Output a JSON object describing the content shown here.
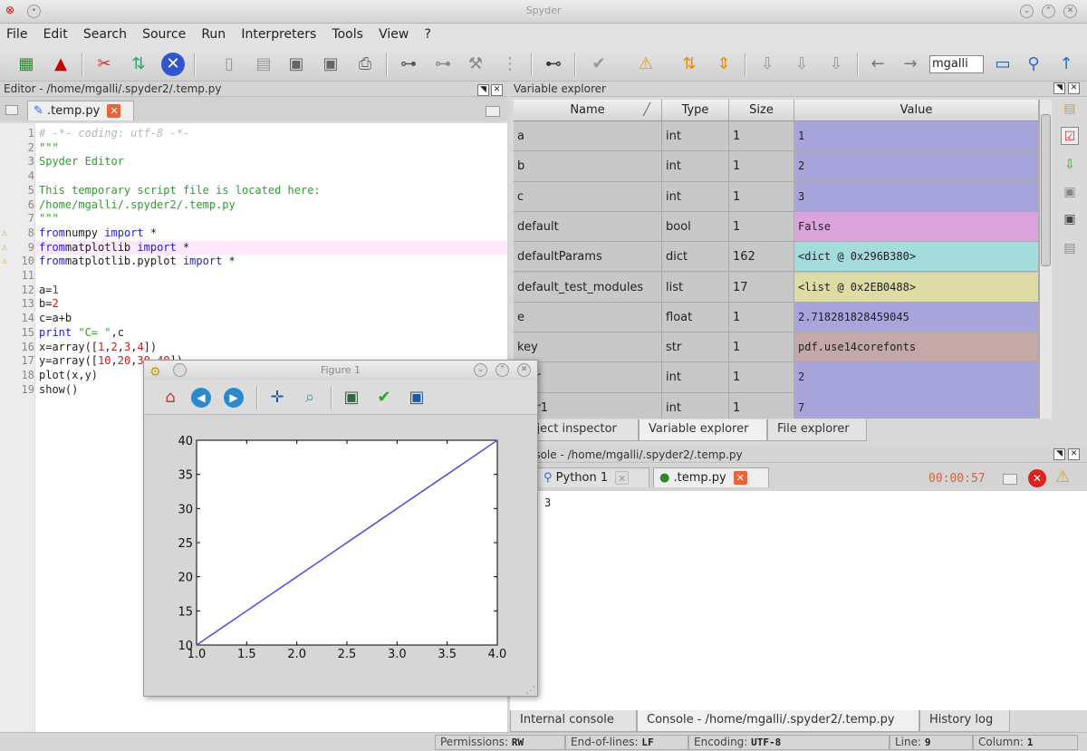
{
  "window": {
    "title": "Spyder"
  },
  "menu": [
    "File",
    "Edit",
    "Search",
    "Source",
    "Run",
    "Interpreters",
    "Tools",
    "View",
    "?"
  ],
  "toolbar": {
    "path_field": "mgalli"
  },
  "editor": {
    "pane_title": "Editor - /home/mgalli/.spyder2/.temp.py",
    "tab": ".temp.py",
    "lines": [
      {
        "n": "1",
        "cls": "cm",
        "t": "# -*- coding: utf-8 -*-"
      },
      {
        "n": "2",
        "cls": "st",
        "t": "\"\"\""
      },
      {
        "n": "3",
        "cls": "st",
        "t": "Spyder Editor"
      },
      {
        "n": "4",
        "cls": "st",
        "t": ""
      },
      {
        "n": "5",
        "cls": "st",
        "t": "This temporary script file is located here:"
      },
      {
        "n": "6",
        "cls": "st",
        "t": "/home/mgalli/.spyder2/.temp.py"
      },
      {
        "n": "7",
        "cls": "st",
        "t": "\"\"\""
      },
      {
        "n": "8",
        "warn": true,
        "parts": [
          [
            "kw",
            "from"
          ],
          [
            "",
            "numpy "
          ],
          [
            "kw",
            "import"
          ],
          [
            "",
            " *"
          ]
        ]
      },
      {
        "n": "9",
        "warn": true,
        "hl": true,
        "parts": [
          [
            "kw",
            "from"
          ],
          [
            "",
            "matplotlib "
          ],
          [
            "kw",
            "import"
          ],
          [
            "",
            " *"
          ]
        ]
      },
      {
        "n": "10",
        "warn": true,
        "parts": [
          [
            "kw",
            "from"
          ],
          [
            "",
            "matplotlib.pyplot "
          ],
          [
            "kw",
            "import"
          ],
          [
            "",
            " *"
          ]
        ]
      },
      {
        "n": "11",
        "t": ""
      },
      {
        "n": "12",
        "parts": [
          [
            "",
            "a="
          ],
          [
            "nm",
            "1"
          ]
        ]
      },
      {
        "n": "13",
        "parts": [
          [
            "",
            "b="
          ],
          [
            "nm",
            "2"
          ]
        ]
      },
      {
        "n": "14",
        "t": "c=a+b"
      },
      {
        "n": "15",
        "parts": [
          [
            "kw",
            "print"
          ],
          [
            "",
            " "
          ],
          [
            "st",
            "\"C= \""
          ],
          [
            "",
            ",c"
          ]
        ]
      },
      {
        "n": "16",
        "parts": [
          [
            "",
            "x=array(["
          ],
          [
            "nm",
            "1"
          ],
          [
            "",
            ","
          ],
          [
            "nm",
            "2"
          ],
          [
            "",
            ","
          ],
          [
            "nm",
            "3"
          ],
          [
            "",
            ","
          ],
          [
            "nm",
            "4"
          ],
          [
            "",
            "])"
          ]
        ]
      },
      {
        "n": "17",
        "parts": [
          [
            "",
            "y=array(["
          ],
          [
            "nm",
            "10"
          ],
          [
            "",
            ","
          ],
          [
            "nm",
            "20"
          ],
          [
            "",
            ","
          ],
          [
            "nm",
            "30"
          ],
          [
            "",
            ","
          ],
          [
            "nm",
            "40"
          ],
          [
            "",
            "])"
          ]
        ]
      },
      {
        "n": "18",
        "t": "plot(x,y)"
      },
      {
        "n": "19",
        "t": "show()"
      }
    ]
  },
  "variable_explorer": {
    "pane_title": "Variable explorer",
    "headers": [
      "Name",
      "Type",
      "Size",
      "Value"
    ],
    "rows": [
      {
        "name": "a",
        "type": "int",
        "size": "1",
        "value": "1",
        "color": "#a8a4dc"
      },
      {
        "name": "b",
        "type": "int",
        "size": "1",
        "value": "2",
        "color": "#a8a4dc"
      },
      {
        "name": "c",
        "type": "int",
        "size": "1",
        "value": "3",
        "color": "#a8a4dc"
      },
      {
        "name": "default",
        "type": "bool",
        "size": "1",
        "value": "False",
        "color": "#dca4dc"
      },
      {
        "name": "defaultParams",
        "type": "dict",
        "size": "162",
        "value": "<dict @ 0x296B380>",
        "color": "#a4dcdc"
      },
      {
        "name": "default_test_modules",
        "type": "list",
        "size": "17",
        "value": "<list @ 0x2EB0488>",
        "color": "#dcdca4"
      },
      {
        "name": "e",
        "type": "float",
        "size": "1",
        "value": "2.718281828459045",
        "color": "#a8a4dc"
      },
      {
        "name": "key",
        "type": "str",
        "size": "1",
        "value": "pdf.use14corefonts",
        "color": "#c4a8a8"
      },
      {
        "name": "...or",
        "type": "int",
        "size": "1",
        "value": "2",
        "color": "#a8a4dc"
      },
      {
        "name": "...or1",
        "type": "int",
        "size": "1",
        "value": "7",
        "color": "#a8a4dc"
      }
    ],
    "bottom_tabs": [
      "Object inspector",
      "Variable explorer",
      "File explorer"
    ]
  },
  "console": {
    "pane_title": "Console - /home/mgalli/.spyder2/.temp.py",
    "tabs": [
      "Python 1",
      ".temp.py"
    ],
    "timer": "00:00:57",
    "output": "3",
    "bottom_tabs": [
      "Internal console",
      "Console - /home/mgalli/.spyder2/.temp.py",
      "History log"
    ]
  },
  "statusbar": {
    "permissions_label": "Permissions:",
    "permissions": "RW",
    "eol_label": "End-of-lines:",
    "eol": "LF",
    "encoding_label": "Encoding:",
    "encoding": "UTF-8",
    "line_label": "Line:",
    "line": "9",
    "column_label": "Column:",
    "column": "1"
  },
  "figure": {
    "title": "Figure 1",
    "chart_data": {
      "type": "line",
      "x": [
        1,
        2,
        3,
        4
      ],
      "series": [
        {
          "values": [
            10,
            20,
            30,
            40
          ],
          "color": "#5555dd"
        }
      ],
      "xlim": [
        1.0,
        4.0
      ],
      "ylim": [
        10,
        40
      ],
      "xticks": [
        "1.0",
        "1.5",
        "2.0",
        "2.5",
        "3.0",
        "3.5",
        "4.0"
      ],
      "yticks": [
        "10",
        "15",
        "20",
        "25",
        "30",
        "35",
        "40"
      ],
      "title": "",
      "xlabel": "",
      "ylabel": "",
      "grid": false
    }
  }
}
